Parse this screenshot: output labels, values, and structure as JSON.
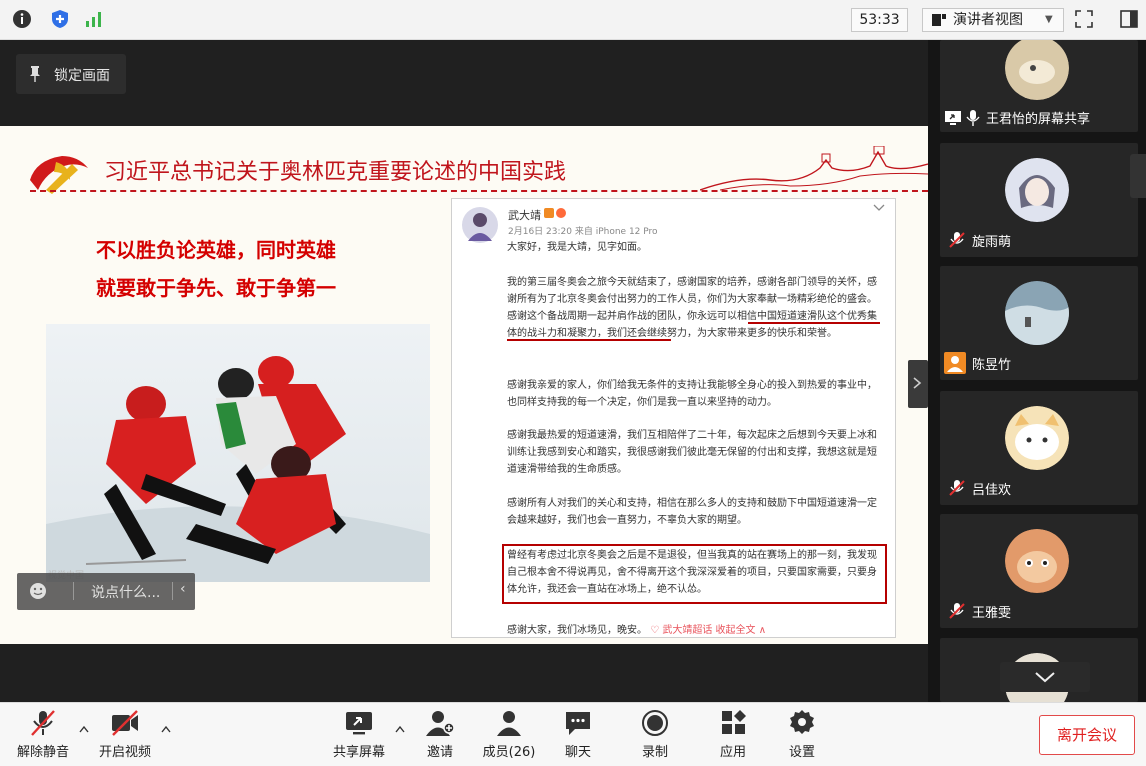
{
  "topbar": {
    "timer": "53:33",
    "view_mode": "演讲者视图"
  },
  "stage": {
    "lock_label": "锁定画面",
    "slide": {
      "title": "习近平总书记关于奥林匹克重要论述的中国实践",
      "slogan_lines": [
        "不以胜负论英雄，同时英雄",
        "就要敢于争先、敢于争第一"
      ],
      "watermark": "视觉中国"
    },
    "post": {
      "author": "武大靖",
      "meta": "2月16日 23:20 来自 iPhone 12 Pro",
      "paragraphs": [
        "大家好，我是大靖，见字如面。",
        "我的第三届冬奥会之旅今天就结束了，感谢国家的培养，感谢各部门领导的关怀，感谢所有为了北京冬奥会付出努力的工作人员，你们为大家奉献一场精彩绝伦的盛会。感谢这个备战周期一起并肩作战的团队，你永远可以相信中国短道速滑队这个优秀集体的战斗力和凝聚力，我们还会继续努力，为大家带来更多的快乐和荣誉。",
        "感谢我亲爱的家人，你们给我无条件的支持让我能够全身心的投入到热爱的事业中，也同样支持我的每一个决定，你们是我一直以来坚持的动力。",
        "感谢我最热爱的短道速滑，我们互相陪伴了二十年，每次起床之后想到今天要上冰和训练让我感到安心和踏实，我很感谢我们彼此毫无保留的付出和支撑，我想这就是短道速滑带给我的生命质感。",
        "感谢所有人对我们的关心和支持，相信在那么多人的支持和鼓励下中国短道速滑一定会越来越好，我们也会一直努力，不辜负大家的期望。",
        "曾经有考虑过北京冬奥会之后是不是退役，但当我真的站在赛场上的那一刻，我发现自己根本舍不得说再见，舍不得离开这个我深深爱着的项目，只要国家需要，只要身体允许，我还会一直站在冰场上，绝不认怂。"
      ],
      "closing": "感谢大家，我们冰场见，晚安。",
      "closing_link": "♡ 武大靖超话 收起全文 ∧"
    },
    "comment_placeholder": "说点什么...",
    "comment_collapse": "‹"
  },
  "participants": [
    {
      "name": "王君怡的屏幕共享",
      "avatar_color": "#d9c9a8"
    },
    {
      "name": "旋雨萌",
      "avatar_color": "#dfe3ef"
    },
    {
      "name": "陈昱竹",
      "avatar_color": "#8aa4b4"
    },
    {
      "name": "吕佳欢",
      "avatar_color": "#f6e3b8"
    },
    {
      "name": "王雅雯",
      "avatar_color": "#e29a6a"
    }
  ],
  "toolbar": {
    "unmute": "解除静音",
    "start_video": "开启视频",
    "share_screen": "共享屏幕",
    "invite": "邀请",
    "members": "成员(26)",
    "chat": "聊天",
    "record": "录制",
    "apps": "应用",
    "settings": "设置",
    "leave": "离开会议"
  },
  "colors": {
    "accent_red": "#c0151c",
    "leave_red": "#e02020",
    "signal_green": "#3cb44b",
    "shield_blue": "#2f6fe6"
  }
}
